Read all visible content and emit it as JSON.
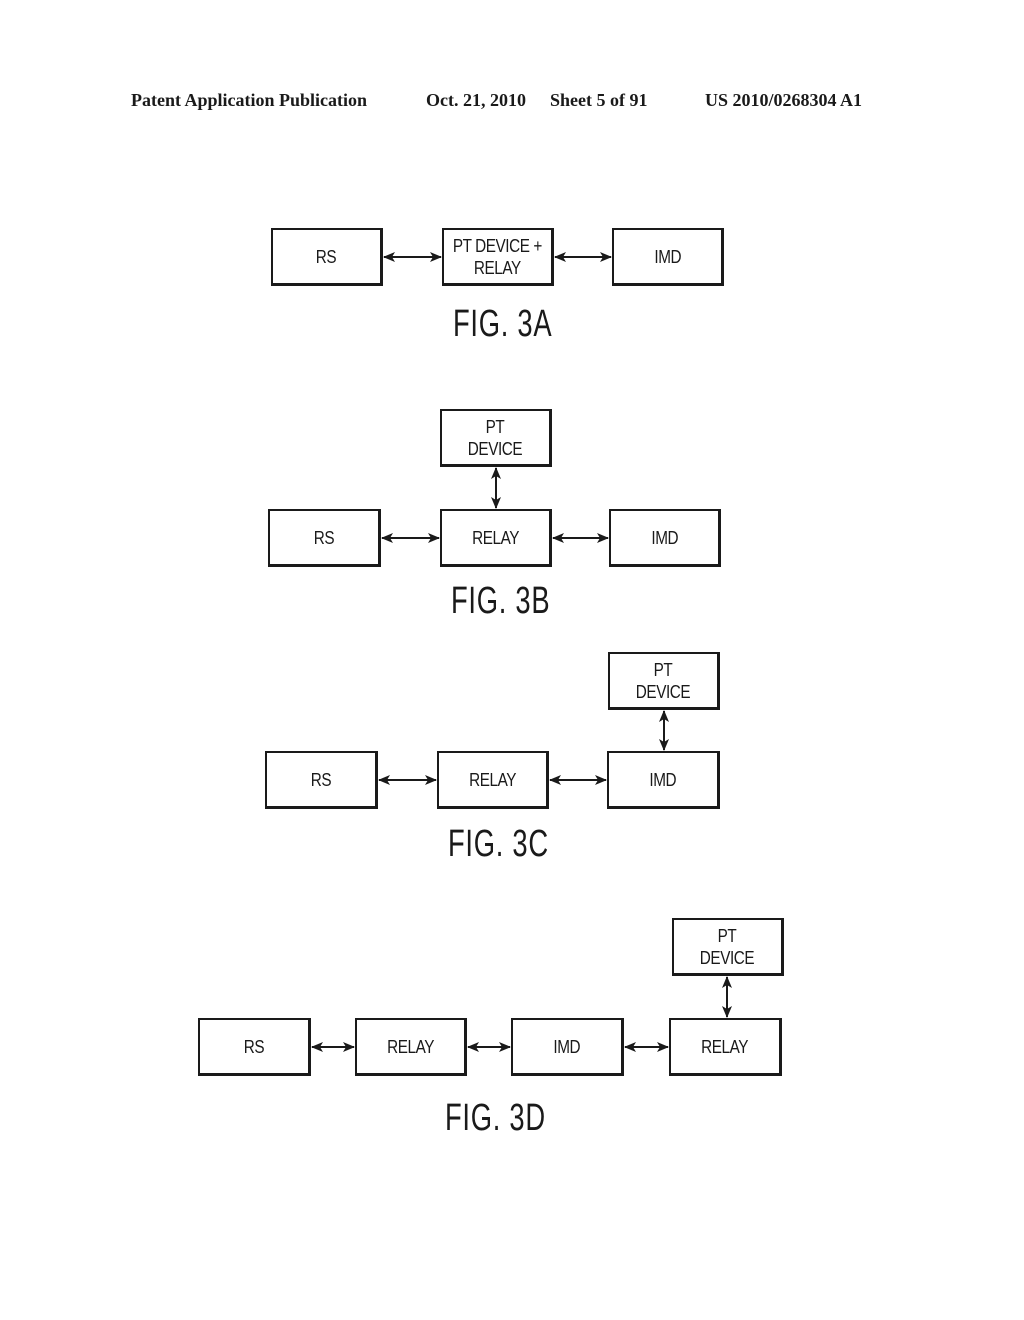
{
  "header": {
    "publication": "Patent Application Publication",
    "date": "Oct. 21, 2010",
    "sheet": "Sheet 5 of 91",
    "number": "US 2010/0268304 A1"
  },
  "figures": [
    {
      "id": "3A",
      "caption": "FIG. 3A",
      "boxes": [
        {
          "id": "a-rs",
          "label": "RS"
        },
        {
          "id": "a-ptrelay",
          "label": "PT DEVICE +\nRELAY"
        },
        {
          "id": "a-imd",
          "label": "IMD"
        }
      ],
      "links": [
        [
          "a-rs",
          "a-ptrelay"
        ],
        [
          "a-ptrelay",
          "a-imd"
        ]
      ]
    },
    {
      "id": "3B",
      "caption": "FIG. 3B",
      "boxes": [
        {
          "id": "b-pt",
          "label": "PT\nDEVICE"
        },
        {
          "id": "b-rs",
          "label": "RS"
        },
        {
          "id": "b-relay",
          "label": "RELAY"
        },
        {
          "id": "b-imd",
          "label": "IMD"
        }
      ],
      "links": [
        [
          "b-pt",
          "b-relay"
        ],
        [
          "b-rs",
          "b-relay"
        ],
        [
          "b-relay",
          "b-imd"
        ]
      ]
    },
    {
      "id": "3C",
      "caption": "FIG. 3C",
      "boxes": [
        {
          "id": "c-pt",
          "label": "PT\nDEVICE"
        },
        {
          "id": "c-rs",
          "label": "RS"
        },
        {
          "id": "c-relay",
          "label": "RELAY"
        },
        {
          "id": "c-imd",
          "label": "IMD"
        }
      ],
      "links": [
        [
          "c-pt",
          "c-imd"
        ],
        [
          "c-rs",
          "c-relay"
        ],
        [
          "c-relay",
          "c-imd"
        ]
      ]
    },
    {
      "id": "3D",
      "caption": "FIG. 3D",
      "boxes": [
        {
          "id": "d-pt",
          "label": "PT\nDEVICE"
        },
        {
          "id": "d-rs",
          "label": "RS"
        },
        {
          "id": "d-relay1",
          "label": "RELAY"
        },
        {
          "id": "d-imd",
          "label": "IMD"
        },
        {
          "id": "d-relay2",
          "label": "RELAY"
        }
      ],
      "links": [
        [
          "d-pt",
          "d-relay2"
        ],
        [
          "d-rs",
          "d-relay1"
        ],
        [
          "d-relay1",
          "d-imd"
        ],
        [
          "d-imd",
          "d-relay2"
        ]
      ]
    }
  ]
}
